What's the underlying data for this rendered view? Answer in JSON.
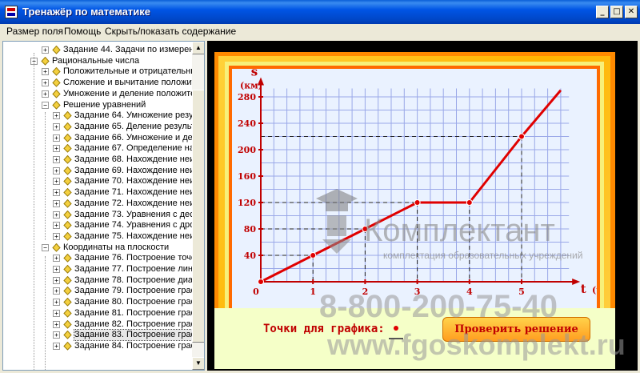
{
  "window": {
    "title": "Тренажёр по математике",
    "minimize": "_",
    "maximize": "□",
    "close": "✕"
  },
  "menu": [
    {
      "label": "Размер поля"
    },
    {
      "label": "Помощь"
    },
    {
      "label": "Скрыть/показать содержание"
    }
  ],
  "tree": {
    "items": [
      {
        "level": 2,
        "label": "Задание 44. Задачи по измерен"
      },
      {
        "level": 1,
        "label": "Рациональные числа",
        "expanded": true
      },
      {
        "level": 2,
        "label": "Положительные и отрицательные"
      },
      {
        "level": 2,
        "label": "Сложение и вычитание положител"
      },
      {
        "level": 2,
        "label": "Умножение и деление положитель"
      },
      {
        "level": 2,
        "label": "Решение уравнений",
        "expanded": true
      },
      {
        "level": 3,
        "label": "Задание 64. Умножение резуль"
      },
      {
        "level": 3,
        "label": "Задание 65. Деление результа"
      },
      {
        "level": 3,
        "label": "Задание 66. Умножение и деле"
      },
      {
        "level": 3,
        "label": "Задание 67. Определение наиб"
      },
      {
        "level": 3,
        "label": "Задание 68. Нахождение неизв"
      },
      {
        "level": 3,
        "label": "Задание 69. Нахождение неизв"
      },
      {
        "level": 3,
        "label": "Задание 70. Нахождение неизв"
      },
      {
        "level": 3,
        "label": "Задание 71. Нахождение неизв"
      },
      {
        "level": 3,
        "label": "Задание 72. Нахождение неизв"
      },
      {
        "level": 3,
        "label": "Задание 73. Уравнения с десят"
      },
      {
        "level": 3,
        "label": "Задание 74. Уравнения с дробн"
      },
      {
        "level": 3,
        "label": "Задание 75. Нахождение неизв"
      },
      {
        "level": 2,
        "label": "Координаты на плоскости",
        "expanded": true
      },
      {
        "level": 3,
        "label": "Задание 76. Построение точек"
      },
      {
        "level": 3,
        "label": "Задание 77. Построение линии"
      },
      {
        "level": 3,
        "label": "Задание 78. Построение диагр"
      },
      {
        "level": 3,
        "label": "Задание 79. Построение графи"
      },
      {
        "level": 3,
        "label": "Задание 80. Построение графи"
      },
      {
        "level": 3,
        "label": "Задание 81. Построение графи"
      },
      {
        "level": 3,
        "label": "Задание 82. Построение графи"
      },
      {
        "level": 3,
        "label": "Задание 83. Построение графи",
        "selected": true
      },
      {
        "level": 3,
        "label": "Задание 84. Построение графи"
      }
    ],
    "scroll_up": "▲",
    "scroll_down": "▼"
  },
  "exercise": {
    "points_label": "Точки для графика:",
    "check_button": "Проверить решение"
  },
  "watermark": {
    "brand": "Комплектант",
    "tagline": "комплектация образовательных учреждений",
    "phone": "8-800-200-75-40",
    "site": "www.fgoskomplekt.ru"
  },
  "chart_data": {
    "type": "line",
    "ylabel": "s",
    "yunit": "(км)",
    "xlabel": "t",
    "xunit": "(ч)",
    "xticks": [
      0,
      1,
      2,
      3,
      4,
      5
    ],
    "yticks": [
      40,
      80,
      120,
      160,
      200,
      240,
      280
    ],
    "xlim": [
      0,
      6
    ],
    "ylim": [
      0,
      300
    ],
    "grid": true,
    "line_color": "#e00000",
    "x": [
      0,
      1,
      2,
      3,
      4,
      5,
      5.75
    ],
    "y": [
      0,
      40,
      80,
      120,
      120,
      220,
      290
    ],
    "marked_points": [
      [
        0,
        0
      ],
      [
        1,
        40
      ],
      [
        2,
        80
      ],
      [
        3,
        120
      ],
      [
        4,
        120
      ],
      [
        5,
        220
      ]
    ]
  }
}
